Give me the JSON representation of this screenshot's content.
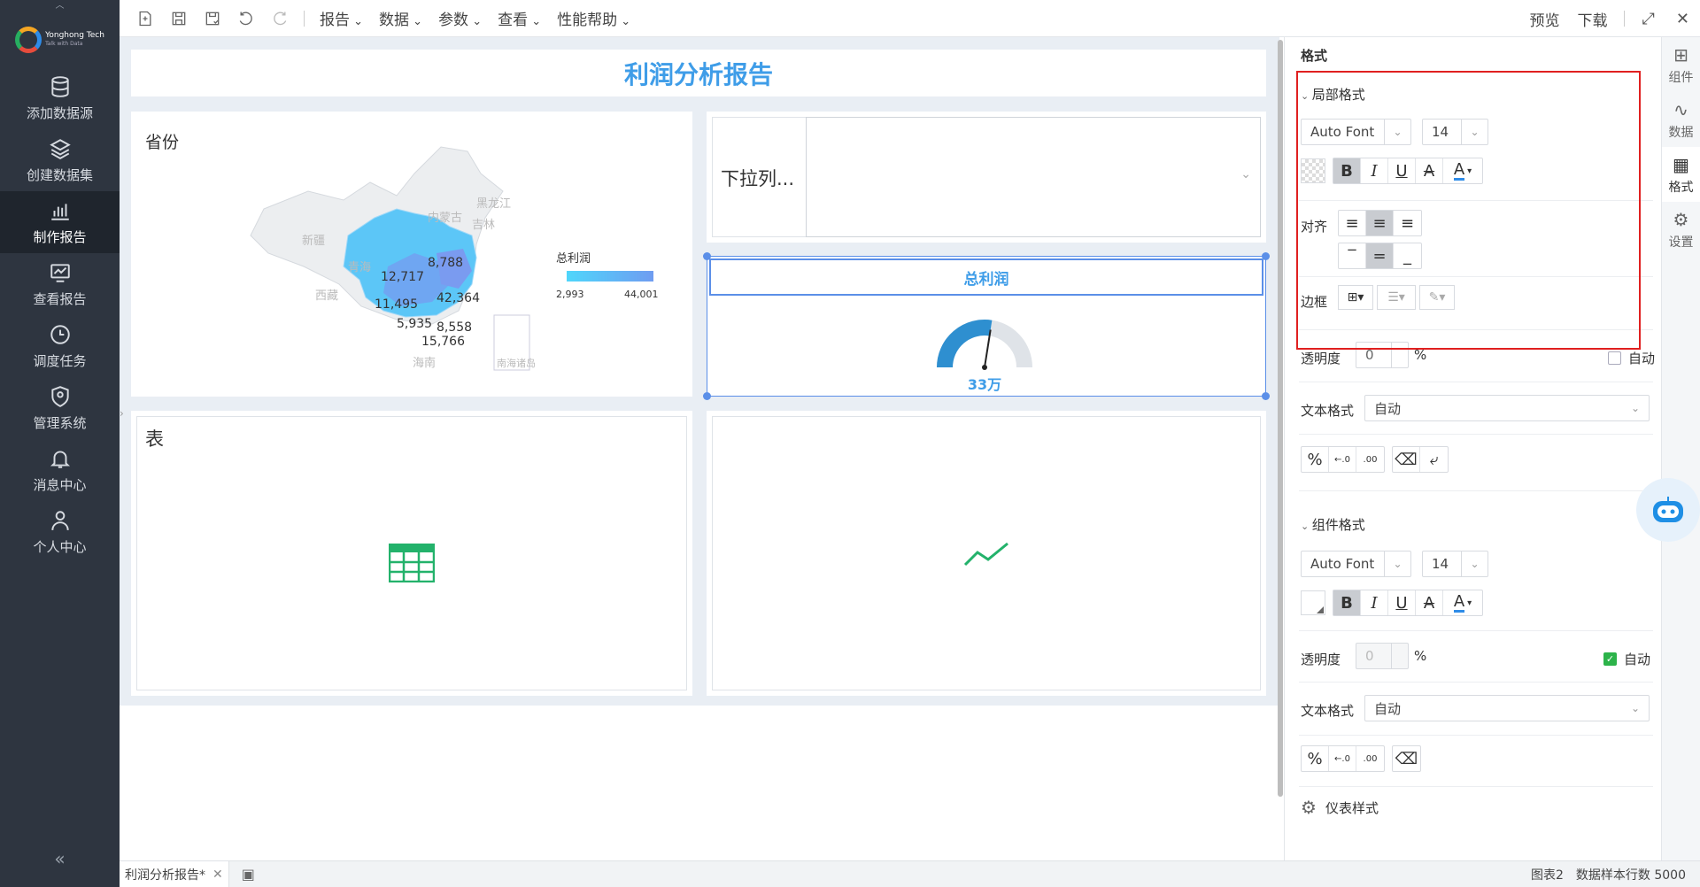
{
  "nav": {
    "items": [
      {
        "label": "添加数据源",
        "icon": "database-icon"
      },
      {
        "label": "创建数据集",
        "icon": "layers-icon"
      },
      {
        "label": "制作报告",
        "icon": "bar-chart-icon"
      },
      {
        "label": "查看报告",
        "icon": "monitor-icon"
      },
      {
        "label": "调度任务",
        "icon": "clock-icon"
      },
      {
        "label": "管理系统",
        "icon": "shield-user-icon"
      },
      {
        "label": "消息中心",
        "icon": "bell-icon"
      },
      {
        "label": "个人中心",
        "icon": "person-icon"
      }
    ],
    "active_index": 2,
    "logo": {
      "name": "Yonghong Tech",
      "tagline": "Talk with Data"
    }
  },
  "toolbar": {
    "menus": [
      "报告",
      "数据",
      "参数",
      "查看",
      "性能帮助"
    ],
    "preview_label": "预览",
    "download_label": "下载"
  },
  "report": {
    "title": "利润分析报告",
    "map": {
      "label": "省份",
      "legend_title": "总利润",
      "legend_min": "2,993",
      "legend_max": "44,001",
      "values": [
        "8,788",
        "12,717",
        "42,364",
        "11,495",
        "5,935",
        "8,558",
        "15,766"
      ],
      "regions": [
        "黑龙江",
        "吉林",
        "内蒙古",
        "新疆",
        "青海",
        "西藏",
        "海南",
        "南海诸岛"
      ]
    },
    "dropdown": {
      "label": "下拉列..."
    },
    "gauge": {
      "title": "总利润",
      "value": "33万",
      "fraction": 0.55
    },
    "table": {
      "label": "表"
    }
  },
  "format_panel": {
    "header": "格式",
    "local_format": {
      "title": "局部格式",
      "font": "Auto Font",
      "size": "14",
      "align_label": "对齐",
      "border_label": "边框"
    },
    "opacity_label": "透明度",
    "opacity_value": "0",
    "percent": "%",
    "auto_label": "自动",
    "text_format_label": "文本格式",
    "text_format_value": "自动",
    "component_format": {
      "title": "组件格式",
      "font": "Auto Font",
      "size": "14",
      "opacity_label": "透明度",
      "opacity_value": "0",
      "auto_label": "自动",
      "text_format_label": "文本格式",
      "text_format_value": "自动"
    },
    "gauge_style_label": "仪表样式"
  },
  "right_tabs": [
    {
      "label": "组件",
      "icon": "component-icon"
    },
    {
      "label": "数据",
      "icon": "data-icon"
    },
    {
      "label": "格式",
      "icon": "grid-icon"
    },
    {
      "label": "设置",
      "icon": "gear-icon"
    }
  ],
  "status": {
    "tab_label": "利润分析报告*",
    "component": "图表2",
    "sample_rows": "数据样本行数 5000"
  },
  "colors": {
    "accent": "#3f9de8",
    "nav_bg": "#2e3540",
    "highlight_red": "#e02020",
    "green": "#2cb34a"
  }
}
